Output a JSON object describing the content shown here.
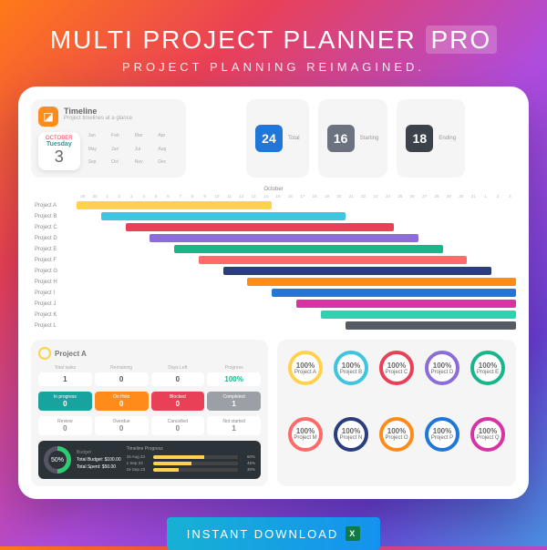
{
  "header": {
    "title": "MULTI PROJECT PLANNER",
    "badge": "PRO",
    "subtitle": "PROJECT PLANNING REIMAGINED."
  },
  "timeline": {
    "title": "Timeline",
    "subtitle": "Project timelines at a glance",
    "month": "OCTOBER",
    "weekday": "Tuesday",
    "day": "3",
    "months": [
      "Jan",
      "Feb",
      "Mar",
      "Apr",
      "May",
      "Jun",
      "Jul",
      "Aug",
      "Sep",
      "Oct",
      "Nov",
      "Dec"
    ]
  },
  "stats": [
    {
      "label": "Total",
      "value": "24",
      "cls": "sb-total"
    },
    {
      "label": "Starting",
      "value": "16",
      "cls": "sb-start"
    },
    {
      "label": "Ending",
      "value": "18",
      "cls": "sb-end"
    }
  ],
  "chart_data": {
    "type": "gantt",
    "month_label": "October",
    "days": [
      "29",
      "30",
      "1",
      "2",
      "3",
      "4",
      "5",
      "6",
      "7",
      "8",
      "9",
      "10",
      "11",
      "12",
      "13",
      "14",
      "15",
      "16",
      "17",
      "18",
      "19",
      "20",
      "21",
      "22",
      "23",
      "24",
      "25",
      "26",
      "27",
      "28",
      "29",
      "30",
      "31",
      "1",
      "2",
      "3"
    ],
    "projects": [
      {
        "label": "Project A",
        "start": 0,
        "len": 16,
        "color": "#ffd24d"
      },
      {
        "label": "Project B",
        "start": 2,
        "len": 20,
        "color": "#40c4e0"
      },
      {
        "label": "Project C",
        "start": 4,
        "len": 22,
        "color": "#e94057"
      },
      {
        "label": "Project D",
        "start": 6,
        "len": 22,
        "color": "#8c6dd8"
      },
      {
        "label": "Project E",
        "start": 8,
        "len": 22,
        "color": "#19b58b"
      },
      {
        "label": "Project F",
        "start": 10,
        "len": 22,
        "color": "#ff6b6b"
      },
      {
        "label": "Project G",
        "start": 12,
        "len": 22,
        "color": "#2a3d7c"
      },
      {
        "label": "Project H",
        "start": 14,
        "len": 22,
        "color": "#ff8c1a"
      },
      {
        "label": "Project I",
        "start": 16,
        "len": 20,
        "color": "#2176d9"
      },
      {
        "label": "Project J",
        "start": 18,
        "len": 18,
        "color": "#d633a3"
      },
      {
        "label": "Project K",
        "start": 20,
        "len": 16,
        "color": "#2dd3b0"
      },
      {
        "label": "Project L",
        "start": 22,
        "len": 14,
        "color": "#555c63"
      }
    ]
  },
  "projectA": {
    "title": "Project A",
    "top": [
      {
        "lbl": "Total tasks",
        "val": "1"
      },
      {
        "lbl": "Remaining",
        "val": "0"
      },
      {
        "lbl": "Days Left",
        "val": "0"
      },
      {
        "lbl": "Progress",
        "val": "100%",
        "green": true
      }
    ],
    "chips": [
      {
        "lbl": "In progress",
        "n": "0",
        "bg": "#19a39e"
      },
      {
        "lbl": "On Hold",
        "n": "0",
        "bg": "#ff8c1a"
      },
      {
        "lbl": "Blocked",
        "n": "0",
        "bg": "#e94057"
      },
      {
        "lbl": "Completed",
        "n": "1",
        "bg": "#9aa0a6"
      }
    ],
    "chips2": [
      {
        "lbl": "Review",
        "n": "0"
      },
      {
        "lbl": "Overdue",
        "n": "0"
      },
      {
        "lbl": "Cancelled",
        "n": "0"
      },
      {
        "lbl": "Not started",
        "n": "1"
      }
    ],
    "budget": {
      "pct": "50%",
      "label": "Budget",
      "total_lbl": "Total Budget:",
      "total": "$100.00",
      "spent_lbl": "Total Spent:",
      "spent": "$50.00"
    },
    "bars": {
      "title": "Timeline Progress",
      "rows": [
        {
          "lbl": "15 Aug 23",
          "pct": 60
        },
        {
          "lbl": "1 Sep 23",
          "pct": 45
        },
        {
          "lbl": "15 Sep 23",
          "pct": 30
        }
      ]
    }
  },
  "circles": [
    {
      "pct": "100%",
      "name": "Project A",
      "color": "#ffd24d"
    },
    {
      "pct": "100%",
      "name": "Project B",
      "color": "#40c4e0"
    },
    {
      "pct": "100%",
      "name": "Project C",
      "color": "#e94057"
    },
    {
      "pct": "100%",
      "name": "Project D",
      "color": "#8c6dd8"
    },
    {
      "pct": "100%",
      "name": "Project E",
      "color": "#19b58b"
    },
    {
      "pct": "100%",
      "name": "Project M",
      "color": "#ff6b6b"
    },
    {
      "pct": "100%",
      "name": "Project N",
      "color": "#2a3d7c"
    },
    {
      "pct": "100%",
      "name": "Project O",
      "color": "#ff8c1a"
    },
    {
      "pct": "100%",
      "name": "Project P",
      "color": "#2176d9"
    },
    {
      "pct": "100%",
      "name": "Project Q",
      "color": "#d633a3"
    }
  ],
  "download": {
    "label": "INSTANT DOWNLOAD",
    "icon": "X"
  }
}
